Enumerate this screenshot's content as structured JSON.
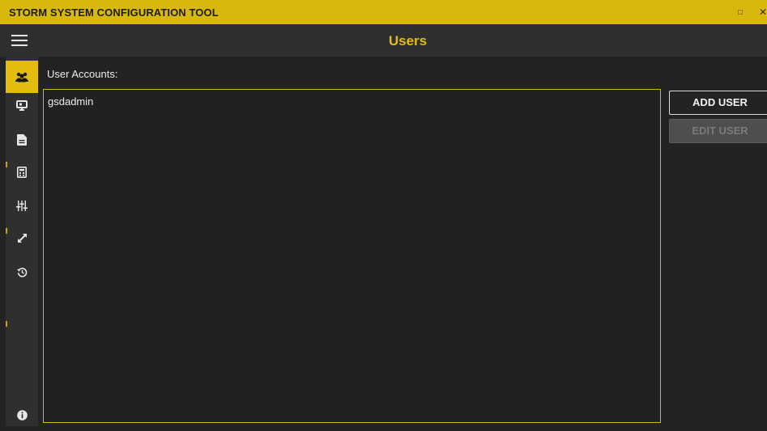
{
  "app": {
    "title": "STORM SYSTEM CONFIGURATION TOOL"
  },
  "window_controls": {
    "maximize_glyph": "□",
    "close_glyph": "✕"
  },
  "header": {
    "page_title": "Users"
  },
  "sidebar": {
    "items": [
      {
        "icon": "users-icon",
        "active": true
      },
      {
        "icon": "display-icon",
        "active": false
      },
      {
        "icon": "document-icon",
        "active": false
      },
      {
        "icon": "calculator-icon",
        "active": false
      },
      {
        "icon": "sliders-icon",
        "active": false
      },
      {
        "icon": "expand-arrow-icon",
        "active": false
      },
      {
        "icon": "history-icon",
        "active": false
      }
    ],
    "footer_icon": "info-icon"
  },
  "main": {
    "accounts_label": "User Accounts:",
    "accounts": [
      "gsdadmin"
    ],
    "add_user_label": "ADD USER",
    "edit_user_label": "EDIT USER",
    "edit_user_enabled": false
  },
  "colors": {
    "accent": "#e3bd0e",
    "background": "#232323",
    "panel": "#2f2f2f"
  }
}
